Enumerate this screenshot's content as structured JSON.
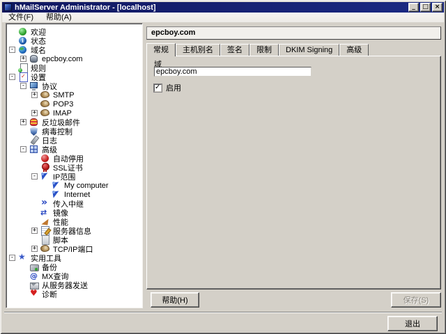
{
  "window": {
    "title": "hMailServer Administrator - [localhost]",
    "controls": [
      {
        "name": "minimize",
        "glyph": "_"
      },
      {
        "name": "maximize",
        "glyph": "□"
      },
      {
        "name": "close",
        "glyph": "×"
      }
    ]
  },
  "menu": {
    "items": [
      {
        "name": "file",
        "label": "文件(F)"
      },
      {
        "name": "help",
        "label": "帮助(A)"
      }
    ]
  },
  "tree": {
    "items": [
      {
        "name": "welcome",
        "label": "欢迎",
        "level": 0,
        "expander": null,
        "icon": "green-ball"
      },
      {
        "name": "status",
        "label": "状态",
        "level": 0,
        "expander": null,
        "icon": "info-ball"
      },
      {
        "name": "domains",
        "label": "域名",
        "level": 0,
        "expander": "-",
        "icon": "globe"
      },
      {
        "name": "domain-epcboy",
        "label": "epcboy.com",
        "level": 1,
        "expander": "+",
        "icon": "database"
      },
      {
        "name": "rules",
        "label": "规则",
        "level": 0,
        "expander": null,
        "icon": "page-rule"
      },
      {
        "name": "settings",
        "label": "设置",
        "level": 0,
        "expander": "-",
        "icon": "checklist"
      },
      {
        "name": "protocols",
        "label": "协议",
        "level": 1,
        "expander": "-",
        "icon": "monitor"
      },
      {
        "name": "smtp",
        "label": "SMTP",
        "level": 2,
        "expander": "+",
        "icon": "shell"
      },
      {
        "name": "pop3",
        "label": "POP3",
        "level": 2,
        "expander": null,
        "icon": "shell"
      },
      {
        "name": "imap",
        "label": "IMAP",
        "level": 2,
        "expander": "+",
        "icon": "shell"
      },
      {
        "name": "anti-spam",
        "label": "反垃圾邮件",
        "level": 1,
        "expander": "+",
        "icon": "spam-cylinder"
      },
      {
        "name": "antivirus",
        "label": "病毒控制",
        "level": 1,
        "expander": null,
        "icon": "shield"
      },
      {
        "name": "logging",
        "label": "日志",
        "level": 1,
        "expander": null,
        "icon": "pen"
      },
      {
        "name": "advanced",
        "label": "高级",
        "level": 1,
        "expander": "-",
        "icon": "grid"
      },
      {
        "name": "auto-ban",
        "label": "自动停用",
        "level": 2,
        "expander": null,
        "icon": "red-ball"
      },
      {
        "name": "ssl-certificates",
        "label": "SSL证书",
        "level": 2,
        "expander": null,
        "icon": "rosette"
      },
      {
        "name": "ip-ranges",
        "label": "IP范围",
        "level": 2,
        "expander": "-",
        "icon": "hand"
      },
      {
        "name": "my-computer",
        "label": "My computer",
        "level": 3,
        "expander": null,
        "icon": "hand"
      },
      {
        "name": "internet",
        "label": "Internet",
        "level": 3,
        "expander": null,
        "icon": "hand"
      },
      {
        "name": "incoming-relays",
        "label": "传入中继",
        "level": 2,
        "expander": null,
        "icon": "chevrons"
      },
      {
        "name": "mirroring",
        "label": "镜像",
        "level": 2,
        "expander": null,
        "icon": "mirror-arrows"
      },
      {
        "name": "performance",
        "label": "性能",
        "level": 2,
        "expander": null,
        "icon": "perf-arrow"
      },
      {
        "name": "server-info",
        "label": "服务器信息",
        "level": 2,
        "expander": "+",
        "icon": "notepad"
      },
      {
        "name": "scripts",
        "label": "脚本",
        "level": 2,
        "expander": null,
        "icon": "script-page"
      },
      {
        "name": "tcpip-ports",
        "label": "TCP/IP端口",
        "level": 2,
        "expander": "+",
        "icon": "shell"
      },
      {
        "name": "utilities",
        "label": "实用工具",
        "level": 0,
        "expander": "-",
        "icon": "star"
      },
      {
        "name": "backup",
        "label": "备份",
        "level": 1,
        "expander": null,
        "icon": "backup-disk"
      },
      {
        "name": "mx-query",
        "label": "MX查询",
        "level": 1,
        "expander": null,
        "icon": "at-sign"
      },
      {
        "name": "send-from-server",
        "label": "从服务器发送",
        "level": 1,
        "expander": null,
        "icon": "envelope"
      },
      {
        "name": "diagnostics",
        "label": "诊断",
        "level": 1,
        "expander": null,
        "icon": "heart"
      }
    ]
  },
  "panel": {
    "header": "epcboy.com",
    "tabs": [
      {
        "name": "general",
        "label": "常规",
        "active": true
      },
      {
        "name": "host-aliases",
        "label": "主机别名",
        "active": false
      },
      {
        "name": "signature",
        "label": "签名",
        "active": false
      },
      {
        "name": "limits",
        "label": "限制",
        "active": false
      },
      {
        "name": "dkim-signing",
        "label": "DKIM Signing",
        "active": false
      },
      {
        "name": "advanced",
        "label": "高级",
        "active": false
      }
    ],
    "form": {
      "domain_label": "域",
      "domain_value": "epcboy.com",
      "enabled_label": "启用",
      "enabled_checked": true
    },
    "buttons": {
      "help": "帮助(H)",
      "save": "保存(S)",
      "save_enabled": false,
      "exit": "退出"
    }
  },
  "colors": {
    "titlebar": "#141e6e",
    "window_bg": "#d4d0c8",
    "tree_bg": "#ffffff",
    "accent_blue": "#2040c0",
    "disabled_text": "#8a867e"
  }
}
